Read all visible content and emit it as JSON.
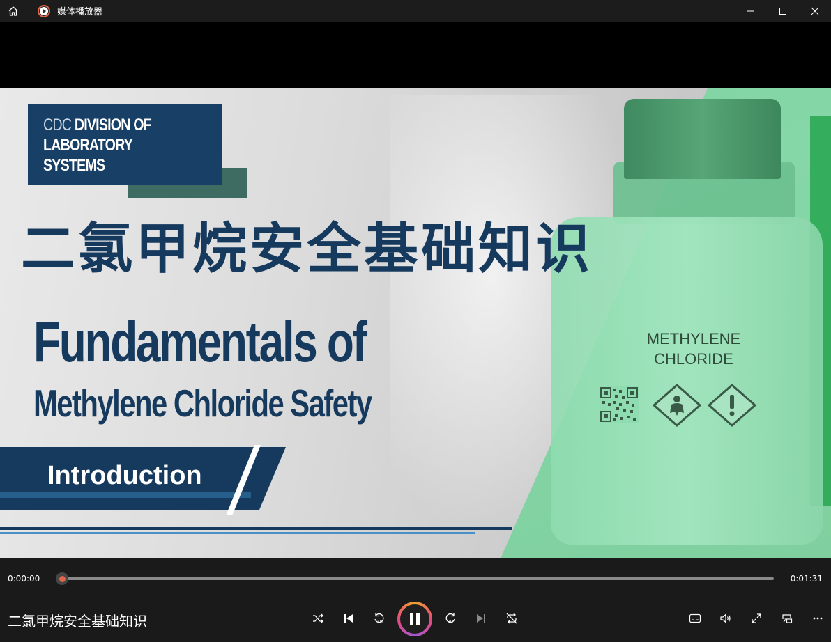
{
  "window": {
    "title": "媒体播放器"
  },
  "video_frame": {
    "cdc_line1_light": "CDC",
    "cdc_line1_bold": "DIVISION OF",
    "cdc_line2": "LABORATORY",
    "cdc_line3": "SYSTEMS",
    "title_cn": "二氯甲烷安全基础知识",
    "title_en_line1": "Fundamentals of",
    "title_en_line2": "Methylene Chloride Safety",
    "chapter": "Introduction",
    "bottle_label_line1": "METHYLENE",
    "bottle_label_line2": "CHLORIDE"
  },
  "playback": {
    "current_time": "0:00:00",
    "total_time": "0:01:31",
    "progress": 0.0,
    "now_playing": "二氯甲烷安全基础知识",
    "state": "playing"
  },
  "colors": {
    "accent_orange": "#e0664a",
    "navy": "#163a5e",
    "green_panel": "#86d7a8"
  },
  "icons": {
    "home": "home-icon",
    "app": "media-player-icon",
    "minimize": "minimize-icon",
    "maximize": "maximize-icon",
    "close": "close-icon",
    "shuffle": "shuffle-icon",
    "previous": "previous-icon",
    "rewind": "rewind-10-icon",
    "pause": "pause-icon",
    "forward": "forward-30-icon",
    "next": "next-icon",
    "repeat": "repeat-off-icon",
    "subtitles": "subtitles-icon",
    "volume": "volume-icon",
    "fullscreen": "fullscreen-icon",
    "miniplayer": "miniplayer-icon",
    "more": "more-icon"
  }
}
